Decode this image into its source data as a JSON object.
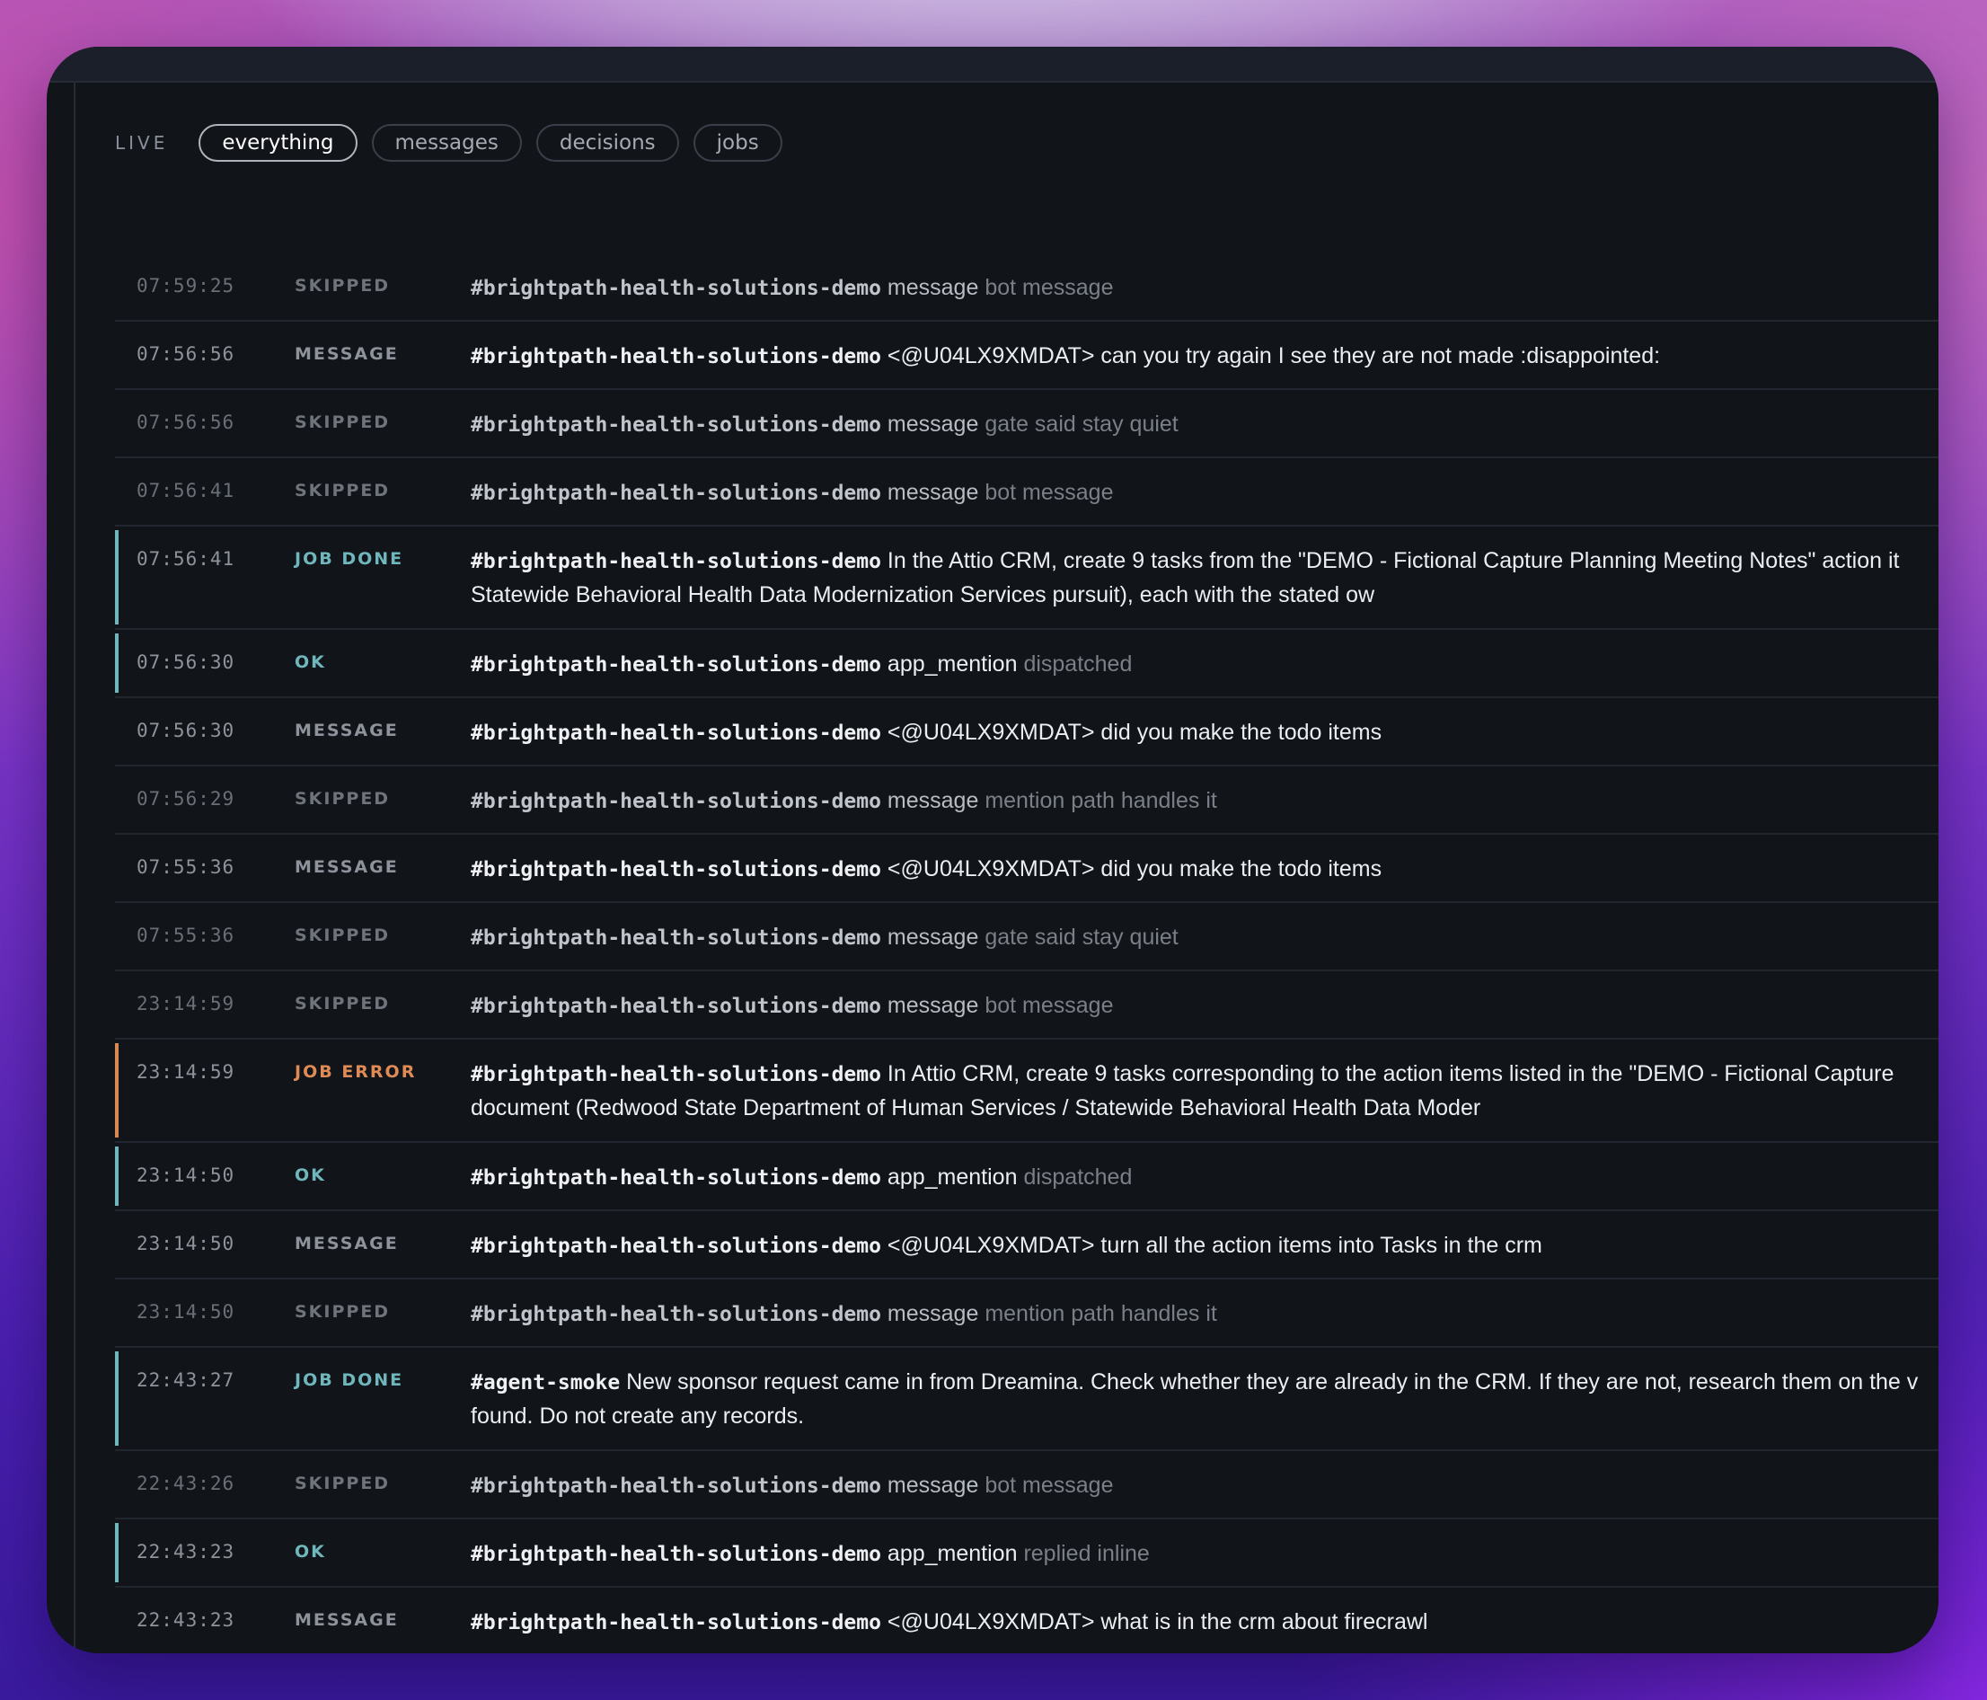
{
  "filters": {
    "live_label": "LIVE",
    "tabs": [
      {
        "label": "everything",
        "active": true
      },
      {
        "label": "messages",
        "active": false
      },
      {
        "label": "decisions",
        "active": false
      },
      {
        "label": "jobs",
        "active": false
      }
    ]
  },
  "colors": {
    "accent_teal": "#6fb7bd",
    "accent_orange": "#d88852",
    "background": "#111419"
  },
  "rows": [
    {
      "time": "07:59:25",
      "status": "SKIPPED",
      "channel": "#brightpath-health-solutions-demo",
      "kind": "message",
      "detail": "bot message"
    },
    {
      "time": "07:56:56",
      "status": "MESSAGE",
      "channel": "#brightpath-health-solutions-demo",
      "kind": "<@U04LX9XMDAT> can you try again I see they are not made :disappointed:",
      "detail": ""
    },
    {
      "time": "07:56:56",
      "status": "SKIPPED",
      "channel": "#brightpath-health-solutions-demo",
      "kind": "message",
      "detail": "gate said stay quiet"
    },
    {
      "time": "07:56:41",
      "status": "SKIPPED",
      "channel": "#brightpath-health-solutions-demo",
      "kind": "message",
      "detail": "bot message"
    },
    {
      "time": "07:56:41",
      "status": "JOB DONE",
      "channel": "#brightpath-health-solutions-demo",
      "kind": "In the Attio CRM, create 9 tasks from the \"DEMO - Fictional Capture Planning Meeting Notes\" action it Statewide Behavioral Health Data Modernization Services pursuit), each with the stated ow",
      "detail": ""
    },
    {
      "time": "07:56:30",
      "status": "OK",
      "channel": "#brightpath-health-solutions-demo",
      "kind": "app_mention",
      "detail": "dispatched"
    },
    {
      "time": "07:56:30",
      "status": "MESSAGE",
      "channel": "#brightpath-health-solutions-demo",
      "kind": "<@U04LX9XMDAT> did you make the todo items",
      "detail": ""
    },
    {
      "time": "07:56:29",
      "status": "SKIPPED",
      "channel": "#brightpath-health-solutions-demo",
      "kind": "message",
      "detail": "mention path handles it"
    },
    {
      "time": "07:55:36",
      "status": "MESSAGE",
      "channel": "#brightpath-health-solutions-demo",
      "kind": "<@U04LX9XMDAT> did you make the todo items",
      "detail": ""
    },
    {
      "time": "07:55:36",
      "status": "SKIPPED",
      "channel": "#brightpath-health-solutions-demo",
      "kind": "message",
      "detail": "gate said stay quiet"
    },
    {
      "time": "23:14:59",
      "status": "SKIPPED",
      "channel": "#brightpath-health-solutions-demo",
      "kind": "message",
      "detail": "bot message"
    },
    {
      "time": "23:14:59",
      "status": "JOB ERROR",
      "channel": "#brightpath-health-solutions-demo",
      "kind": "In Attio CRM, create 9 tasks corresponding to the action items listed in the \"DEMO - Fictional Capture document (Redwood State Department of Human Services / Statewide Behavioral Health Data Moder",
      "detail": ""
    },
    {
      "time": "23:14:50",
      "status": "OK",
      "channel": "#brightpath-health-solutions-demo",
      "kind": "app_mention",
      "detail": "dispatched"
    },
    {
      "time": "23:14:50",
      "status": "MESSAGE",
      "channel": "#brightpath-health-solutions-demo",
      "kind": "<@U04LX9XMDAT> turn all the action items into Tasks in the crm",
      "detail": ""
    },
    {
      "time": "23:14:50",
      "status": "SKIPPED",
      "channel": "#brightpath-health-solutions-demo",
      "kind": "message",
      "detail": "mention path handles it"
    },
    {
      "time": "22:43:27",
      "status": "JOB DONE",
      "channel": "#agent-smoke",
      "kind": "New sponsor request came in from Dreamina. Check whether they are already in the CRM. If they are not, research them on the v found. Do not create any records.",
      "detail": ""
    },
    {
      "time": "22:43:26",
      "status": "SKIPPED",
      "channel": "#brightpath-health-solutions-demo",
      "kind": "message",
      "detail": "bot message"
    },
    {
      "time": "22:43:23",
      "status": "OK",
      "channel": "#brightpath-health-solutions-demo",
      "kind": "app_mention",
      "detail": "replied inline"
    },
    {
      "time": "22:43:23",
      "status": "MESSAGE",
      "channel": "#brightpath-health-solutions-demo",
      "kind": "<@U04LX9XMDAT> what is in the crm about firecrawl",
      "detail": ""
    }
  ]
}
